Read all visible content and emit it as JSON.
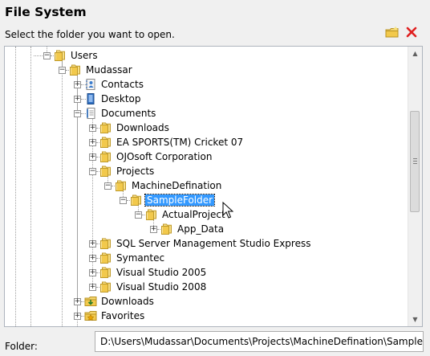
{
  "dialog": {
    "title": "File System",
    "subtitle": "Select the folder you want to open.",
    "folder_label": "Folder:",
    "folder_path": "D:\\Users\\Mudassar\\Documents\\Projects\\MachineDefination\\SampleFolder"
  },
  "tree": {
    "items": [
      {
        "label": "Users",
        "icon": "folder-icon",
        "expander": "minus",
        "level": 0
      },
      {
        "label": "Mudassar",
        "icon": "folder-icon",
        "expander": "minus",
        "level": 1
      },
      {
        "label": "Contacts",
        "icon": "contacts-icon",
        "expander": "plus",
        "level": 2
      },
      {
        "label": "Desktop",
        "icon": "desktop-icon",
        "expander": "plus",
        "level": 2
      },
      {
        "label": "Documents",
        "icon": "documents-icon",
        "expander": "minus",
        "level": 2
      },
      {
        "label": "Downloads",
        "icon": "folder-icon",
        "expander": "plus",
        "level": 3
      },
      {
        "label": "EA SPORTS(TM) Cricket 07",
        "icon": "folder-icon",
        "expander": "plus",
        "level": 3
      },
      {
        "label": "OJOsoft Corporation",
        "icon": "folder-icon",
        "expander": "plus",
        "level": 3
      },
      {
        "label": "Projects",
        "icon": "folder-icon",
        "expander": "minus",
        "level": 3
      },
      {
        "label": "MachineDefination",
        "icon": "folder-icon",
        "expander": "minus",
        "level": 4
      },
      {
        "label": "SampleFolder",
        "icon": "folder-icon",
        "expander": "minus",
        "level": 5,
        "selected": true
      },
      {
        "label": "ActualProject",
        "icon": "folder-icon",
        "expander": "minus",
        "level": 6
      },
      {
        "label": "App_Data",
        "icon": "folder-icon",
        "expander": "plus",
        "level": 7
      },
      {
        "label": "SQL Server Management Studio Express",
        "icon": "folder-icon",
        "expander": "plus",
        "level": 3
      },
      {
        "label": "Symantec",
        "icon": "folder-icon",
        "expander": "plus",
        "level": 3
      },
      {
        "label": "Visual Studio 2005",
        "icon": "folder-icon",
        "expander": "plus",
        "level": 3
      },
      {
        "label": "Visual Studio 2008",
        "icon": "folder-icon",
        "expander": "plus",
        "level": 3
      },
      {
        "label": "Downloads",
        "icon": "downloads-icon",
        "expander": "plus",
        "level": 2
      },
      {
        "label": "Favorites",
        "icon": "favorites-icon",
        "expander": "plus",
        "level": 2
      }
    ]
  },
  "colors": {
    "selection": "#3399ff",
    "folder": "#f2c94c",
    "delete": "#e02020"
  }
}
